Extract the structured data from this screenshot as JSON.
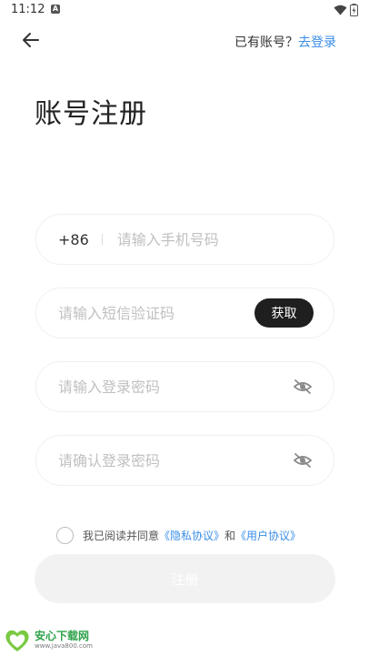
{
  "status_bar": {
    "time": "11:12",
    "notification_badge": "A"
  },
  "header": {
    "login_prompt": "已有账号？",
    "login_action": "去登录"
  },
  "title": "账号注册",
  "form": {
    "country_code": "+86",
    "phone_placeholder": "请输入手机号码",
    "code_placeholder": "请输入短信验证码",
    "get_code_label": "获取",
    "password_placeholder": "请输入登录密码",
    "confirm_placeholder": "请确认登录密码"
  },
  "agreement": {
    "checked": false,
    "prefix": "我已阅读并同意",
    "privacy_link": "《隐私协议》",
    "conjunction": "和",
    "user_link": "《用户协议》"
  },
  "submit_label": "注册",
  "watermark": {
    "name": "安心下载网",
    "url": "www.java800.com"
  },
  "colors": {
    "accent": "#3a8ee6",
    "button_dark": "#1f1f1f",
    "submit_disabled": "#f2f2f2"
  },
  "icons": [
    "back-arrow-icon",
    "eye-off-icon",
    "wifi-icon",
    "battery-icon"
  ]
}
